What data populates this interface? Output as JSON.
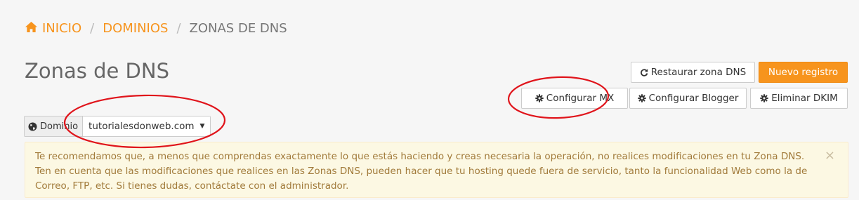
{
  "breadcrumb": {
    "home": "INICIO",
    "domains": "DOMINIOS",
    "current": "ZONAS DE DNS",
    "separator": "/"
  },
  "page": {
    "title": "Zonas de DNS"
  },
  "actions": {
    "restore": "Restaurar zona DNS",
    "new_record": "Nuevo registro",
    "configure_mx": "Configurar MX",
    "configure_blogger": "Configurar Blogger",
    "delete_dkim": "Eliminar DKIM"
  },
  "domain_selector": {
    "label": "Dominio",
    "selected": "tutorialesdonweb.com",
    "caret": "▼"
  },
  "alert": {
    "text": "Te recomendamos que, a menos que comprendas exactamente lo que estás haciendo y creas necesaria la operación, no realices modificaciones en tu Zona DNS. Ten en cuenta que las modificaciones que realices en las Zonas DNS, pueden hacer que tu hosting quede fuera de servicio, tanto la funcionalidad Web como la de Correo, FTP, etc. Si tienes dudas, contáctate con el administrador.",
    "close": "×"
  },
  "colors": {
    "accent": "#f7941d",
    "annotation": "#e0141b",
    "alert_bg": "#fcf8e3",
    "alert_text": "#a17a3a"
  },
  "icons": {
    "home": "home-icon",
    "restore": "refresh-icon",
    "gear": "gear-icon",
    "globe": "globe-icon"
  }
}
